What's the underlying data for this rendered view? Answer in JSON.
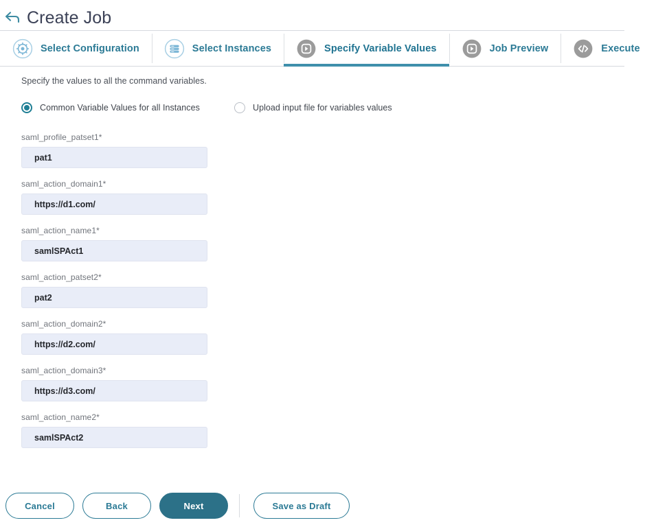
{
  "header": {
    "back_icon": "back-arrow-icon",
    "title": "Create Job"
  },
  "tabs": [
    {
      "label": "Select Configuration",
      "icon": "gear-circle-icon",
      "state": "done"
    },
    {
      "label": "Select Instances",
      "icon": "server-stack-circle-icon",
      "state": "done"
    },
    {
      "label": "Specify Variable Values",
      "icon": "play-square-circle-icon",
      "state": "active"
    },
    {
      "label": "Job Preview",
      "icon": "play-square-circle-icon",
      "state": "upcoming"
    },
    {
      "label": "Execute",
      "icon": "code-brackets-circle-icon",
      "state": "upcoming"
    }
  ],
  "main": {
    "intro": "Specify the values to all the command variables.",
    "options": [
      {
        "label": "Common Variable Values for all Instances",
        "selected": true
      },
      {
        "label": "Upload input file for variables values",
        "selected": false
      }
    ],
    "fields": [
      {
        "label": "saml_profile_patset1*",
        "value": "pat1",
        "placeholder": ""
      },
      {
        "label": "saml_action_domain1*",
        "value": "https://d1.com/",
        "placeholder": ""
      },
      {
        "label": "saml_action_name1*",
        "value": "samlSPAct1",
        "placeholder": ""
      },
      {
        "label": "saml_action_patset2*",
        "value": "pat2",
        "placeholder": ""
      },
      {
        "label": "saml_action_domain2*",
        "value": "https://d2.com/",
        "placeholder": ""
      },
      {
        "label": "saml_action_domain3*",
        "value": "https://d3.com/",
        "placeholder": ""
      },
      {
        "label": "saml_action_name2*",
        "value": "samlSPAct2",
        "placeholder": ""
      }
    ]
  },
  "footer": {
    "cancel": "Cancel",
    "back": "Back",
    "next": "Next",
    "save_draft": "Save as Draft"
  },
  "colors": {
    "accent_teal": "#2b7a95",
    "primary_button": "#2c7188",
    "active_tab_underline": "#3f8fab",
    "input_bg": "#e9edf8",
    "title_text": "#3c4257",
    "inactive_icon_gray": "#9e9e9e"
  }
}
